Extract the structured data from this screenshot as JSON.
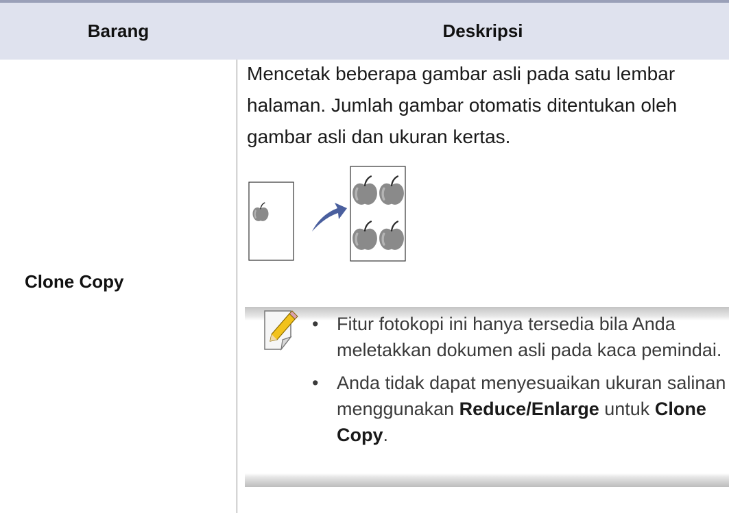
{
  "table": {
    "header_item": "Barang",
    "header_desc": "Deskripsi",
    "row": {
      "item": "Clone Copy",
      "description": "Mencetak beberapa gambar asli pada satu lembar halaman. Jumlah gambar otomatis ditentukan oleh gambar asli dan ukuran kertas."
    }
  },
  "note": {
    "icon": "note-pencil-icon",
    "bullet_char": "•",
    "item1": "Fitur fotokopi ini hanya tersedia bila Anda meletakkan dokumen asli pada kaca pemindai.",
    "item2_prefix": "Anda tidak dapat menyesuaikan ukuran salinan menggunakan",
    "item2_bold1": "Reduce/Enlarge",
    "item2_mid": "untuk",
    "item2_bold2": "Clone Copy",
    "item2_suffix": "."
  },
  "colors": {
    "header_bg": "#dfe2ee",
    "top_rule": "#9aa0b8",
    "arrow": "#4a5f9e",
    "apple": "#8a8a8a"
  }
}
